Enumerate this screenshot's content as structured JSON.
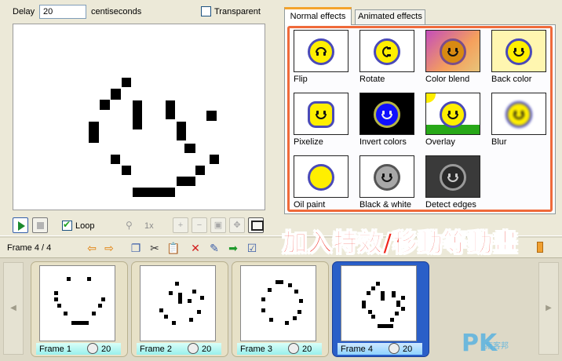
{
  "toolbar_top": {
    "delay_label": "Delay",
    "delay_value": "20",
    "delay_unit": "centiseconds",
    "transparent_label": "Transparent"
  },
  "playback": {
    "loop_label": "Loop",
    "loop_checked": true,
    "zoom_label": "1x"
  },
  "effects": {
    "tabs": [
      {
        "label": "Normal effects",
        "active": true
      },
      {
        "label": "Animated effects",
        "active": false
      }
    ],
    "items": [
      {
        "label": "Flip"
      },
      {
        "label": "Rotate"
      },
      {
        "label": "Color blend"
      },
      {
        "label": "Back color"
      },
      {
        "label": "Pixelize"
      },
      {
        "label": "Invert colors"
      },
      {
        "label": "Overlay"
      },
      {
        "label": "Blur"
      },
      {
        "label": "Oil paint"
      },
      {
        "label": "Black & white"
      },
      {
        "label": "Detect edges"
      }
    ],
    "highlight_color": "#ef6a3a"
  },
  "caption": "加入特效/移動等動畫",
  "frames_toolbar": {
    "frame_counter": "Frame 4 / 4"
  },
  "frames": [
    {
      "name": "Frame 1",
      "delay": "20",
      "selected": false
    },
    {
      "name": "Frame 2",
      "delay": "20",
      "selected": false
    },
    {
      "name": "Frame 3",
      "delay": "20",
      "selected": false
    },
    {
      "name": "Frame 4",
      "delay": "20",
      "selected": true
    }
  ],
  "watermark": {
    "logo": "PK",
    "sub": "痞客邦"
  }
}
